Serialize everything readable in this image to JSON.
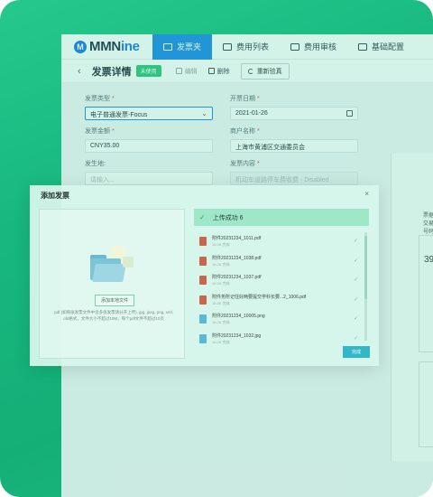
{
  "brand": {
    "name_part1": "MMN",
    "name_part2": "ine",
    "logo_letter": "M"
  },
  "nav": {
    "tabs": [
      {
        "label": "发票夹",
        "active": true
      },
      {
        "label": "费用列表"
      },
      {
        "label": "费用审核"
      },
      {
        "label": "基础配置"
      }
    ]
  },
  "subbar": {
    "back_icon": "‹",
    "title": "发票详情",
    "status_badge": "未使用",
    "edit_label": "编辑",
    "delete_label": "删除",
    "reverify_label": "重新验真"
  },
  "form": {
    "invoice_type": {
      "label": "发票类型",
      "value": "电子普通发票-Focus",
      "chevron": "⌄"
    },
    "issue_date": {
      "label": "开票日期",
      "value": "2021-01-26"
    },
    "amount": {
      "label": "发票金额",
      "value": "CNY35.00"
    },
    "merchant": {
      "label": "商户名称",
      "value": "上海市黄浦区交通委员会"
    },
    "origin": {
      "label": "发生地:",
      "placeholder": "请输入..."
    },
    "content": {
      "label": "发票内容",
      "value": "机动车道路停车费收费 - Disabled"
    }
  },
  "side_panel": {
    "lines": [
      "票据",
      "交易",
      "号码"
    ],
    "number": "39"
  },
  "modal": {
    "title": "添加发票",
    "close_icon": "×",
    "upload_button": "添加本地文件",
    "hint": "pdf (如每张发票文件中含多张发票请分开上传), jpg, jpeg, png, xml, ofd格式，文件大小不超过10M，每个pdf文件不超过10页",
    "success_text": "上传成功 6",
    "check_icon": "✓",
    "done_button": "完成",
    "files": [
      {
        "name": "附件20231234_1011.pdf",
        "meta": "10.2K    完成",
        "type": "pdf"
      },
      {
        "name": "附件20231234_1038.pdf",
        "meta": "10.2K    完成",
        "type": "pdf"
      },
      {
        "name": "附件20231234_1037.pdf",
        "meta": "10.2K    完成",
        "type": "pdf"
      },
      {
        "name": "附件务所记住好两要提交学科长要...2_1006.pdf",
        "meta": "10.2K    完成",
        "type": "pdf"
      },
      {
        "name": "附件20231234_10005.png",
        "meta": "10.2K    完成",
        "type": "png"
      },
      {
        "name": "附件20231234_1032.jpg",
        "meta": "10.2K    完成",
        "type": "jpg"
      }
    ]
  }
}
